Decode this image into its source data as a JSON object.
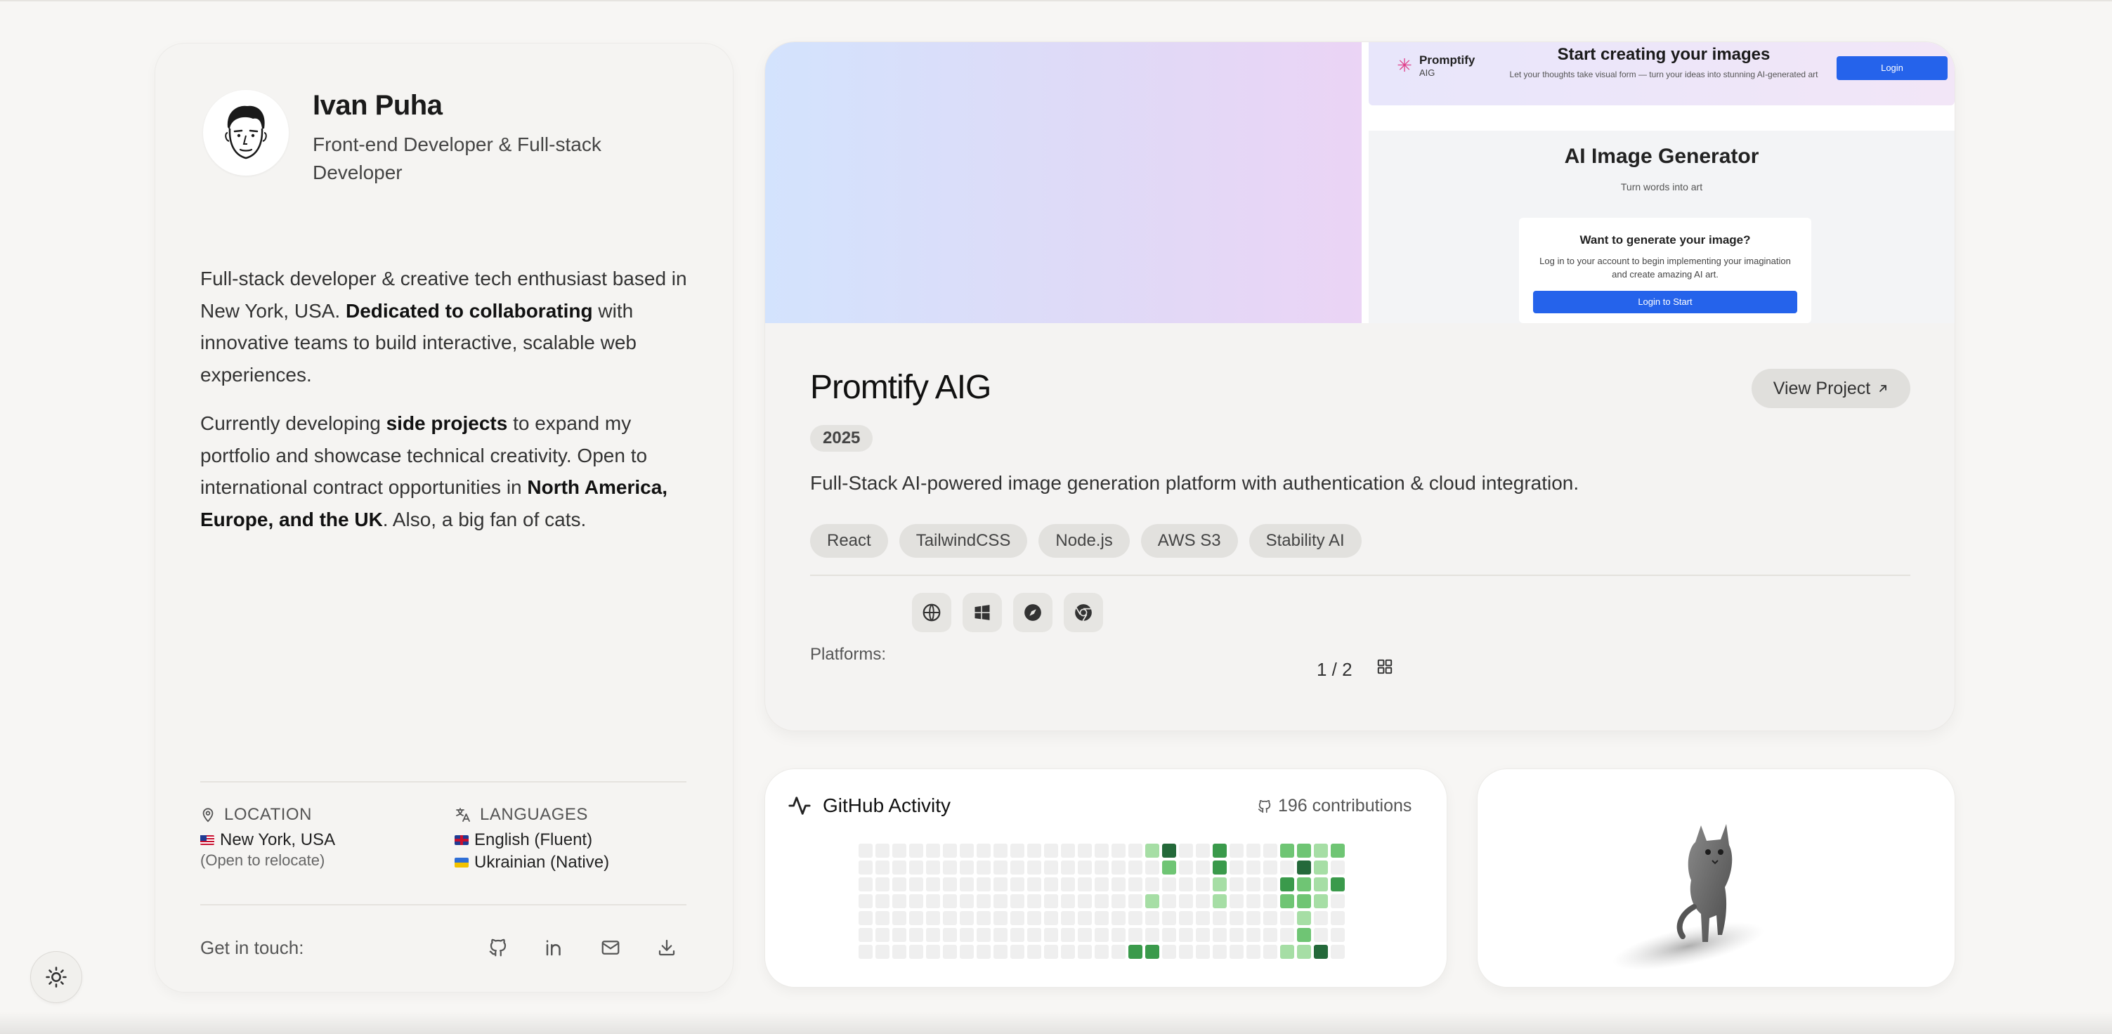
{
  "profile": {
    "name": "Ivan Puha",
    "role": "Front-end Developer & Full-stack Developer",
    "bio1_a": "Full-stack developer & creative tech enthusiast based in New York, USA. ",
    "bio1_b": "Dedicated to collaborating",
    "bio1_c": " with innovative teams to build interactive, scalable web experiences.",
    "bio2_a": "Currently developing ",
    "bio2_b": "side projects",
    "bio2_c": " to expand my portfolio and showcase technical creativity. Open to international contract opportunities in ",
    "bio2_d": "North America, Europe, and the UK",
    "bio2_e": ". Also, a big fan of cats."
  },
  "location": {
    "heading": "LOCATION",
    "city": "New York, USA",
    "note": "(Open to relocate)"
  },
  "languages": {
    "heading": "LANGUAGES",
    "items": [
      "English (Fluent)",
      "Ukrainian (Native)"
    ]
  },
  "contact": {
    "label": "Get in touch:",
    "icons": [
      "github-icon",
      "linkedin-icon",
      "mail-icon",
      "download-icon"
    ]
  },
  "theme_toggle_icon": "sun-icon",
  "project": {
    "preview": {
      "logo_text": "Promptify",
      "logo_sub": "AIG",
      "header_title": "Start creating your images",
      "header_sub": "Let your thoughts take visual form — turn your ideas into stunning AI-generated art",
      "login": "Login",
      "app_title": "AI Image Generator",
      "app_sub": "Turn words into art",
      "panel_title": "Want to generate your image?",
      "panel_desc": "Log in to your account to begin implementing your imagination and create amazing AI art.",
      "panel_button": "Login to Start"
    },
    "title": "Promtify AIG",
    "year": "2025",
    "view_label": "View Project",
    "description": "Full-Stack AI-powered image generation platform with authentication & cloud integration.",
    "tags": [
      "React",
      "TailwindCSS",
      "Node.js",
      "AWS S3",
      "Stability AI"
    ],
    "platforms_label": "Platforms:",
    "platforms": [
      "globe-icon",
      "windows-icon",
      "safari-icon",
      "chrome-icon"
    ],
    "pager": "1 / 2"
  },
  "github": {
    "title": "GitHub Activity",
    "contributions": "196 contributions",
    "weeks": [
      [
        0,
        0,
        0,
        0,
        0,
        0,
        0
      ],
      [
        0,
        0,
        0,
        0,
        0,
        0,
        0
      ],
      [
        0,
        0,
        0,
        0,
        0,
        0,
        0
      ],
      [
        0,
        0,
        0,
        0,
        0,
        0,
        0
      ],
      [
        0,
        0,
        0,
        0,
        0,
        0,
        0
      ],
      [
        0,
        0,
        0,
        0,
        0,
        0,
        0
      ],
      [
        0,
        0,
        0,
        0,
        0,
        0,
        0
      ],
      [
        0,
        0,
        0,
        0,
        0,
        0,
        0
      ],
      [
        0,
        0,
        0,
        0,
        0,
        0,
        0
      ],
      [
        0,
        0,
        0,
        0,
        0,
        0,
        0
      ],
      [
        0,
        0,
        0,
        0,
        0,
        0,
        0
      ],
      [
        0,
        0,
        0,
        0,
        0,
        0,
        0
      ],
      [
        0,
        0,
        0,
        0,
        0,
        0,
        0
      ],
      [
        0,
        0,
        0,
        0,
        0,
        0,
        0
      ],
      [
        0,
        0,
        0,
        0,
        0,
        0,
        0
      ],
      [
        0,
        0,
        0,
        0,
        0,
        0,
        0
      ],
      [
        0,
        0,
        0,
        0,
        0,
        0,
        3
      ],
      [
        1,
        0,
        0,
        1,
        0,
        0,
        3
      ],
      [
        4,
        2,
        0,
        0,
        0,
        0,
        0
      ],
      [
        0,
        0,
        0,
        0,
        0,
        0,
        0
      ],
      [
        0,
        0,
        0,
        0,
        0,
        0,
        0
      ],
      [
        3,
        3,
        1,
        1,
        0,
        0,
        0
      ],
      [
        0,
        0,
        0,
        0,
        0,
        0,
        0
      ],
      [
        0,
        0,
        0,
        0,
        0,
        0,
        0
      ],
      [
        0,
        0,
        0,
        0,
        0,
        0,
        0
      ],
      [
        2,
        0,
        3,
        2,
        0,
        0,
        1
      ],
      [
        2,
        4,
        2,
        2,
        1,
        2,
        1
      ],
      [
        1,
        1,
        1,
        1,
        0,
        0,
        4
      ],
      [
        2,
        0,
        3,
        0,
        0,
        0,
        0
      ]
    ]
  },
  "colors": {
    "accent": "#2563eb",
    "contrib_levels": [
      "#efefef",
      "#a6dea5",
      "#6fc574",
      "#3a9a4b",
      "#24693a"
    ]
  }
}
